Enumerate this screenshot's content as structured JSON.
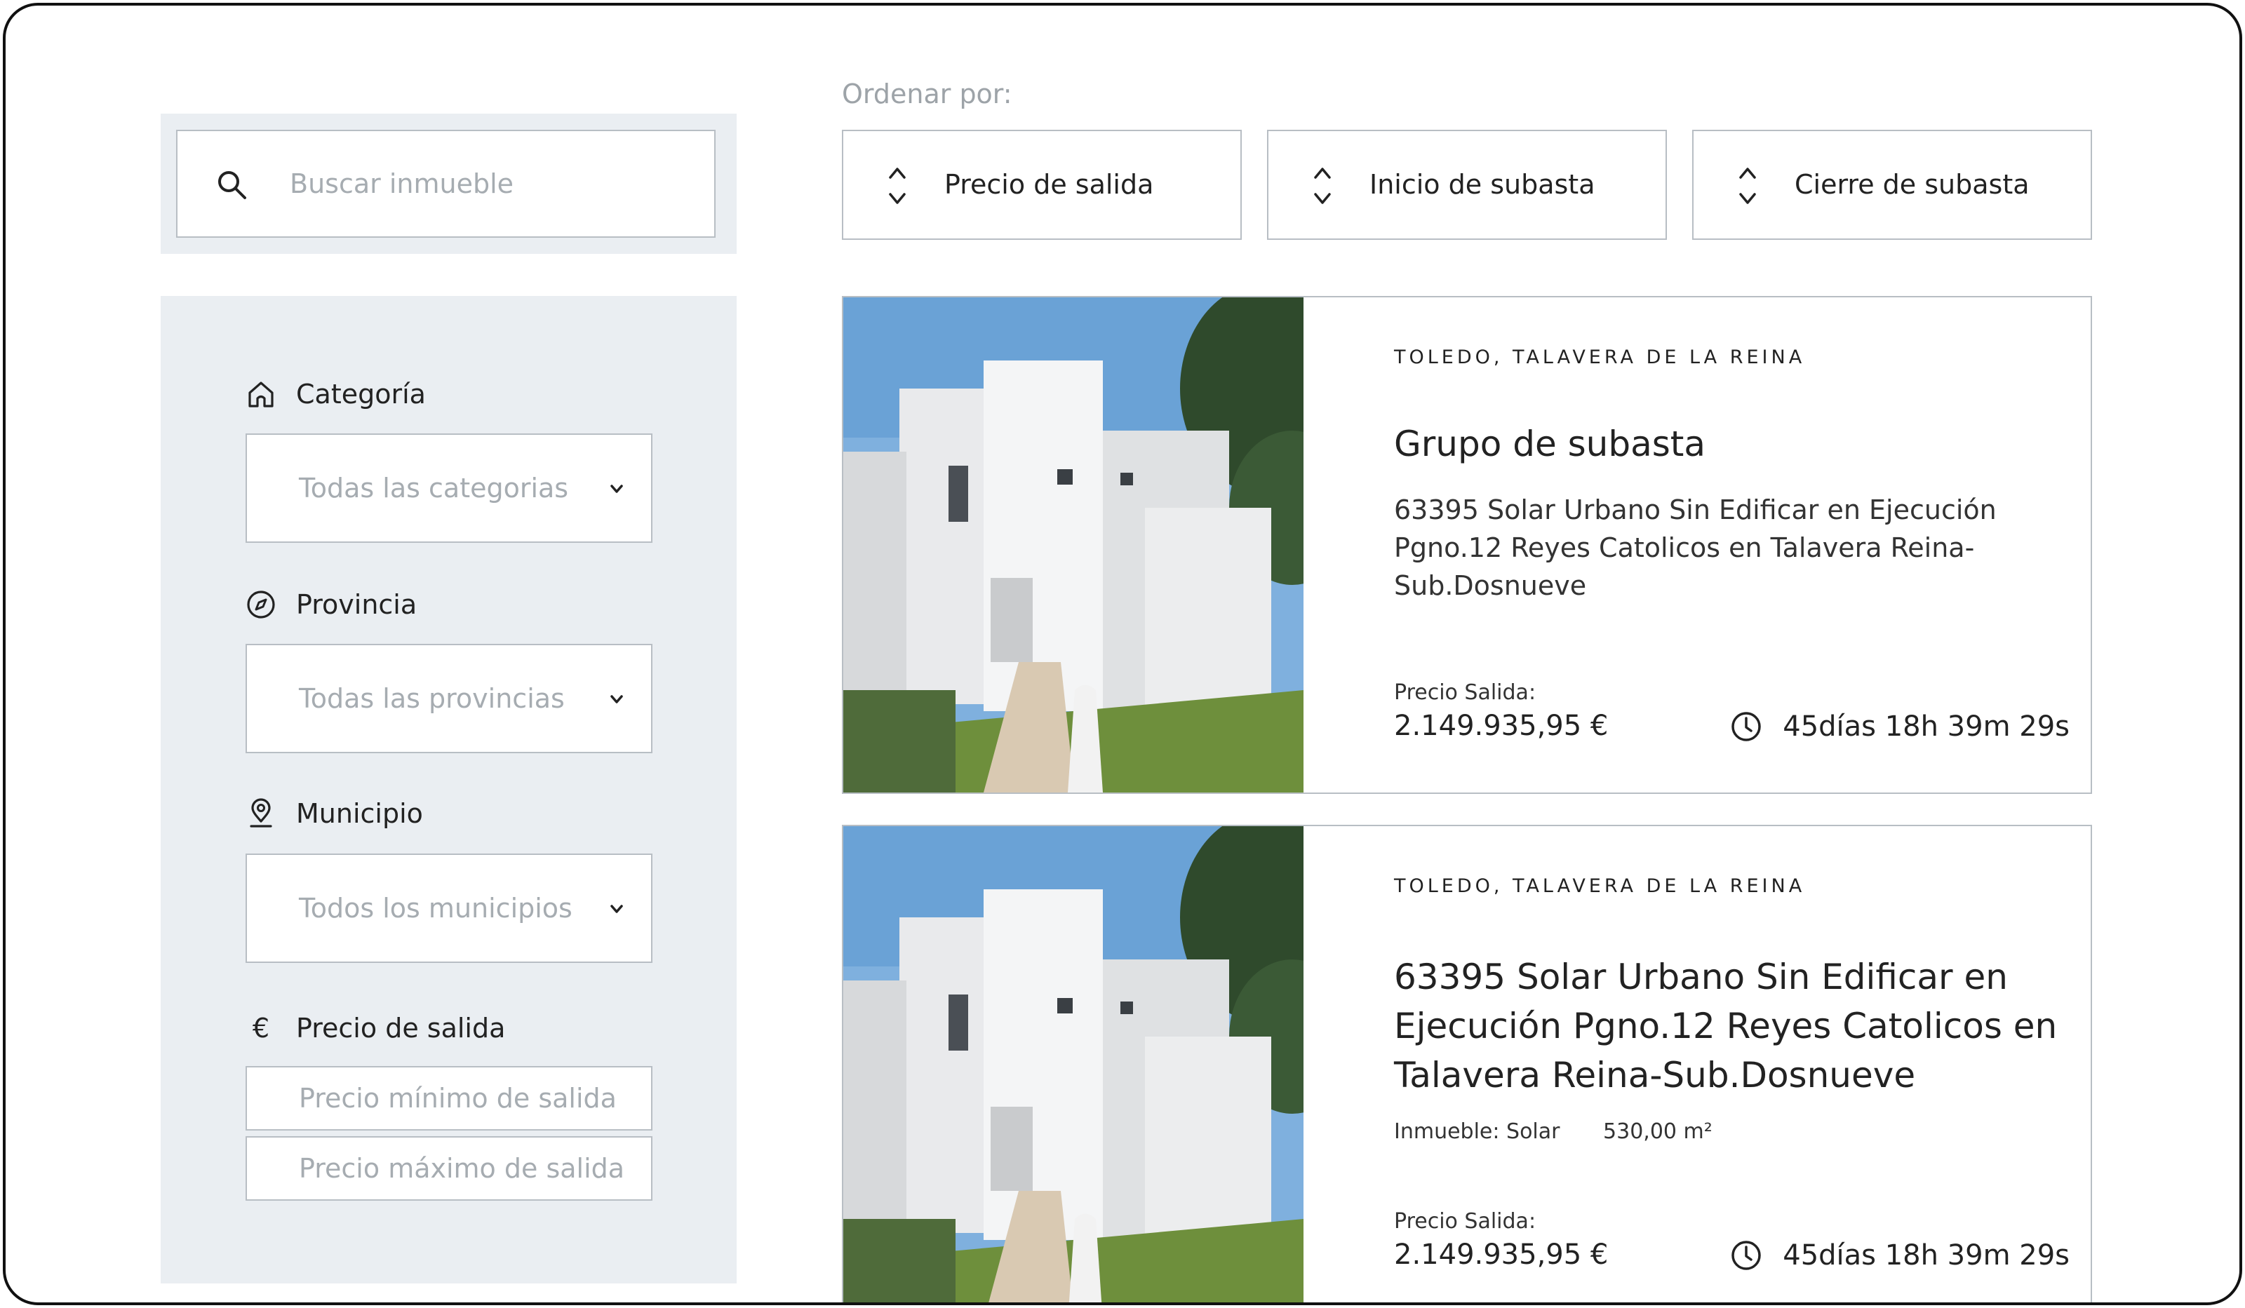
{
  "search": {
    "placeholder": "Buscar inmueble"
  },
  "sort": {
    "label": "Ordenar por:",
    "buttons": [
      {
        "label": "Precio de salida"
      },
      {
        "label": "Inicio de subasta"
      },
      {
        "label": "Cierre de subasta"
      }
    ]
  },
  "filters": {
    "categoria": {
      "label": "Categoría",
      "value": "Todas las categorias",
      "icon": "home-icon"
    },
    "provincia": {
      "label": "Provincia",
      "value": "Todas las provincias",
      "icon": "compass-icon"
    },
    "municipio": {
      "label": "Municipio",
      "value": "Todos los municipios",
      "icon": "location-pin-icon"
    },
    "precio": {
      "label": "Precio de salida",
      "icon": "euro-icon",
      "icon_glyph": "€",
      "min_placeholder": "Precio mínimo de salida",
      "max_placeholder": "Precio máximo de salida"
    }
  },
  "listings": [
    {
      "location": "TOLEDO, TALAVERA DE LA REINA",
      "title": "Grupo de subasta",
      "description": "63395 Solar Urbano Sin Edificar en Ejecución Pgno.12 Reyes Catolicos en Talavera Reina-Sub.Dosnueve",
      "price_label": "Precio Salida:",
      "price": "2.149.935,95 €",
      "time_left": "45días 18h 39m 29s"
    },
    {
      "location": "TOLEDO, TALAVERA DE LA REINA",
      "title": "63395 Solar Urbano Sin Edificar en Ejecución Pgno.12 Reyes Catolicos en Talavera Reina-Sub.Dosnueve",
      "property_type": "Inmueble: Solar",
      "area": "530,00 m²",
      "price_label": "Precio Salida:",
      "price": "2.149.935,95 €",
      "time_left": "45días 18h 39m 29s"
    }
  ],
  "colors": {
    "panel_bg": "#eaeef2",
    "border": "#b8bec4",
    "placeholder": "#a6acb1",
    "text": "#222222"
  }
}
